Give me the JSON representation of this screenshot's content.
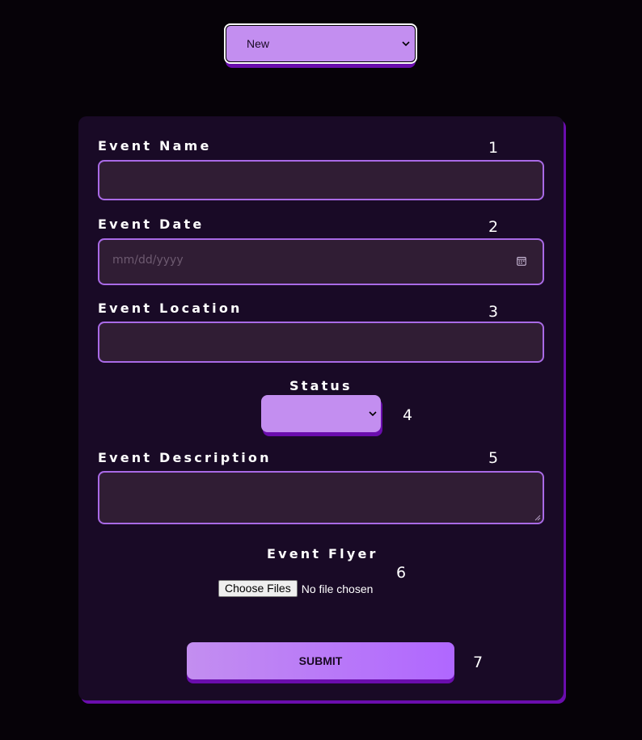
{
  "mode_select": {
    "value": "New"
  },
  "form": {
    "event_name": {
      "label": "Event Name",
      "number": "1",
      "value": ""
    },
    "event_date": {
      "label": "Event Date",
      "number": "2",
      "placeholder": "mm/dd/yyyy"
    },
    "event_location": {
      "label": "Event Location",
      "number": "3",
      "value": ""
    },
    "status": {
      "label": "Status",
      "number": "4",
      "value": ""
    },
    "event_description": {
      "label": "Event Description",
      "number": "5",
      "value": ""
    },
    "event_flyer": {
      "label": "Event Flyer",
      "number": "6",
      "button_label": "Choose Files",
      "file_status": "No file chosen"
    },
    "submit": {
      "label": "SUBMIT",
      "number": "7"
    }
  },
  "colors": {
    "background": "#060208",
    "card": "#190a26",
    "card_shadow": "#6a0dad",
    "field_bg": "#301d34",
    "field_border": "#a96ae6",
    "select_bg": "#c38ef0",
    "submit_gradient_end": "#b067ff"
  },
  "icons": {
    "select_chevron": "chevron-down-icon",
    "date_picker": "calendar-icon",
    "textarea_resize": "resize-grip-icon"
  }
}
